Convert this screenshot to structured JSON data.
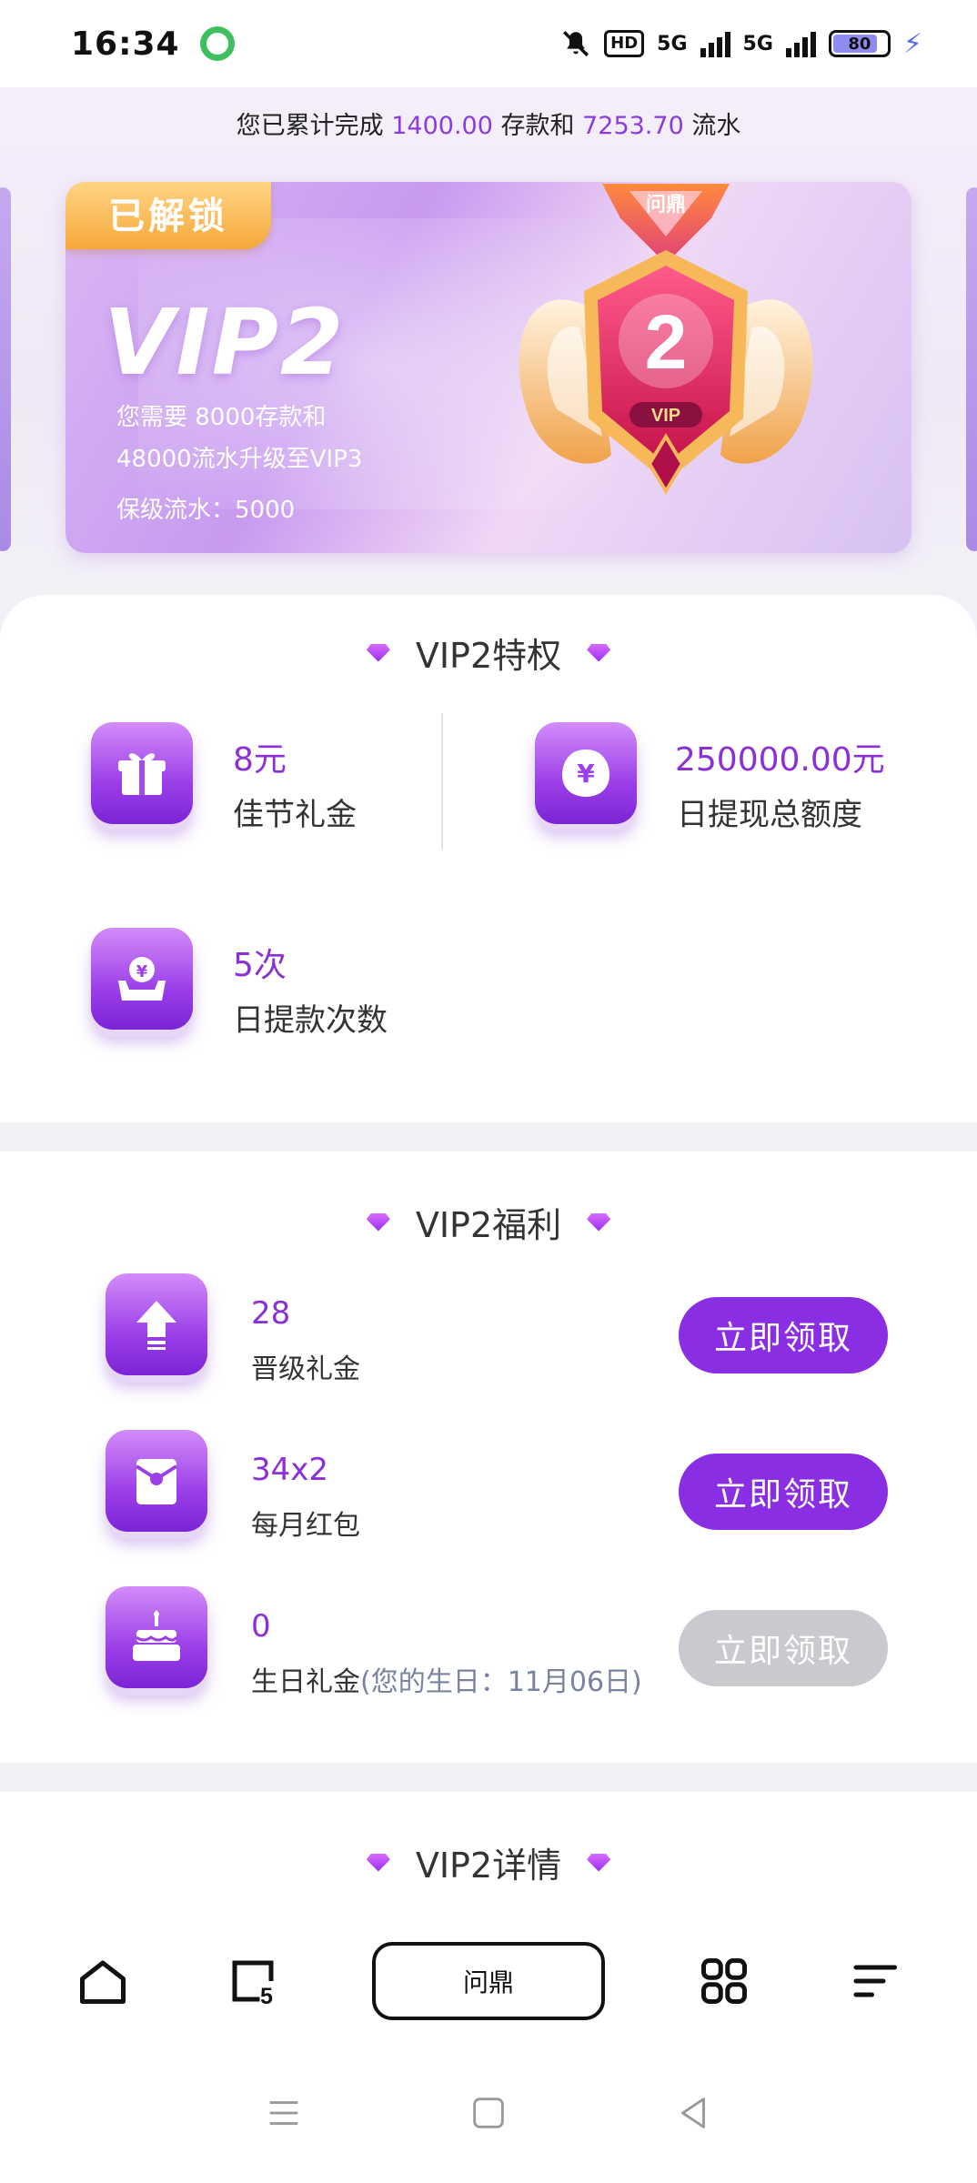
{
  "status_bar": {
    "time": "16:34",
    "hd_label": "HD",
    "net1": "5G",
    "net2": "5G",
    "battery": "80"
  },
  "progress": {
    "prefix": "您已累计完成",
    "deposit": "1400.00",
    "mid": "存款和",
    "turnover": "7253.70",
    "suffix": "流水"
  },
  "vip_card": {
    "unlocked_label": "已解锁",
    "title": "VIP2",
    "desc_line1": "您需要 8000存款和",
    "desc_line2": "48000流水升级至VIP3",
    "keep_level": "保级流水：5000",
    "badge_brand": "问鼎",
    "badge_number": "2",
    "badge_vip": "VIP"
  },
  "privileges": {
    "title": "VIP2特权",
    "items": [
      {
        "value": "8元",
        "label": "佳节礼金",
        "icon": "gift-icon"
      },
      {
        "value": "250000.00元",
        "label": "日提现总额度",
        "icon": "yen-bag-icon"
      },
      {
        "value": "5次",
        "label": "日提款次数",
        "icon": "withdraw-icon"
      }
    ]
  },
  "welfare": {
    "title": "VIP2福利",
    "items": [
      {
        "value": "28",
        "label": "晋级礼金",
        "sub": "",
        "button": "立即领取",
        "enabled": true,
        "icon": "upgrade-arrow-icon"
      },
      {
        "value": "34x2",
        "label": "每月红包",
        "sub": "",
        "button": "立即领取",
        "enabled": true,
        "icon": "red-envelope-icon"
      },
      {
        "value": "0",
        "label": "生日礼金",
        "sub": "(您的生日：11月06日)",
        "button": "立即领取",
        "enabled": false,
        "icon": "birthday-cake-icon"
      }
    ]
  },
  "details": {
    "title": "VIP2详情"
  },
  "browser_bar": {
    "url_text": "问鼎",
    "tab_count": "5"
  },
  "colors": {
    "accent": "#8a2ee3",
    "value_purple": "#8b2fd6",
    "disabled": "#c9c9cf"
  }
}
